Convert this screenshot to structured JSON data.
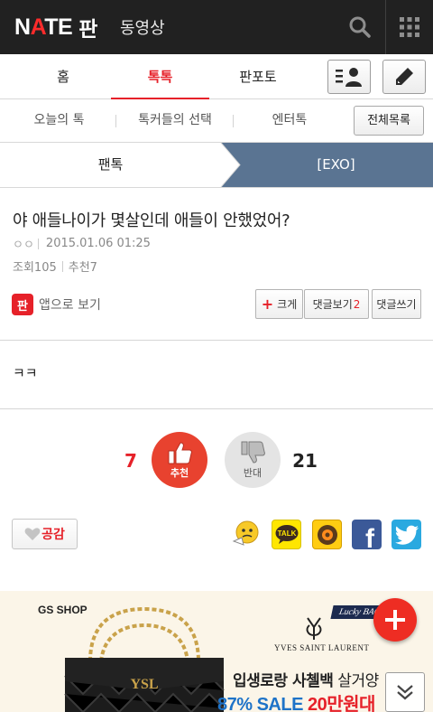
{
  "header": {
    "logo": {
      "nate_pre": "N",
      "nate_accent": "A",
      "nate_post": "TE",
      "pan": "판"
    },
    "video_link": "동영상",
    "icons": {
      "search": "search-icon",
      "apps": "apps-grid-icon"
    }
  },
  "tabs": [
    {
      "label": "홈",
      "active": false
    },
    {
      "label": "톡톡",
      "active": true
    },
    {
      "label": "판포토",
      "active": false
    }
  ],
  "tab_icons": {
    "profile": "profile-list-icon",
    "write": "pencil-icon"
  },
  "subtabs": [
    {
      "label": "오늘의 톡"
    },
    {
      "label": "톡커들의 선택"
    },
    {
      "label": "엔터톡"
    }
  ],
  "all_list_label": "전체목록",
  "breadcrumb": {
    "parent": "팬톡",
    "current": "[EXO]"
  },
  "post": {
    "title": "야 애들나이가 몇살인데 애들이 안했었어?",
    "author": "ㅇㅇ",
    "datetime": "2015.01.06 01:25",
    "views": "조회105",
    "recommends": "추천7",
    "body": "ㅋㅋ"
  },
  "actions": {
    "app_badge": "판",
    "app_view": "앱으로 보기",
    "bigger": "크게",
    "comments_view": "댓글보기",
    "comments_count": "2",
    "comment_write": "댓글쓰기"
  },
  "vote": {
    "up_count": "7",
    "up_label": "추천",
    "down_label": "반대",
    "down_count": "21"
  },
  "empathy_label": "공감",
  "share": [
    {
      "name": "emoticon-share-icon"
    },
    {
      "name": "kakaotalk-icon",
      "label": "TALK"
    },
    {
      "name": "kakaostory-icon"
    },
    {
      "name": "facebook-icon",
      "label": "f"
    },
    {
      "name": "twitter-icon"
    }
  ],
  "ad": {
    "brand": "GS SHOP",
    "lucky": "Lucky BAG",
    "ysl": "YVES SAINT LAURENT",
    "headline_bold": "입생로랑 사첼백",
    "headline_rest": " 살거양",
    "sale_blue": "87% SALE ",
    "sale_red": "20만원대"
  },
  "colors": {
    "accent": "#e62129",
    "topbar": "#212121",
    "crumb_blue": "#5a7492",
    "facebook": "#3b5998",
    "twitter": "#2aa9e0",
    "kakao": "#ffe600"
  }
}
